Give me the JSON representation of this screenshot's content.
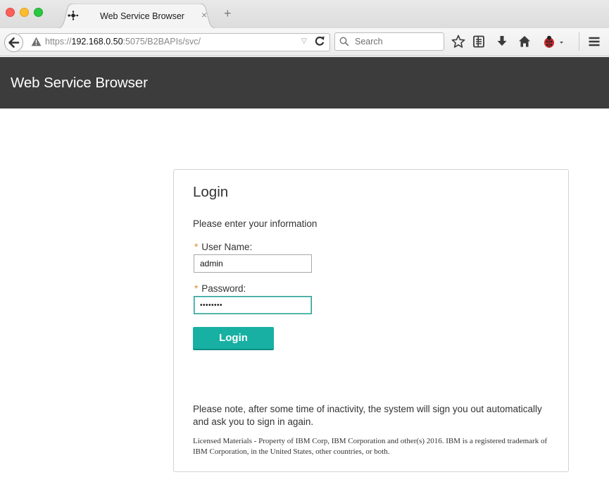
{
  "browser": {
    "tab": {
      "title": "Web Service Browser",
      "close_glyph": "×"
    },
    "new_tab_glyph": "+",
    "url": {
      "scheme": "https://",
      "host": "192.168.0.50",
      "rest": ":5075/B2BAPIs/svc/"
    },
    "search_placeholder": "Search",
    "url_dropmark": "▽",
    "toolbar_icons": [
      "bookmark-star-icon",
      "reader-list-icon",
      "download-icon",
      "home-icon",
      "ladybug-extension-icon",
      "menu-icon"
    ]
  },
  "app": {
    "title": "Web Service Browser"
  },
  "login": {
    "heading": "Login",
    "instructions": "Please enter your information",
    "required_mark": "*",
    "username_label": "User Name:",
    "username_value": "admin",
    "password_label": "Password:",
    "password_value": "••••••••",
    "button_label": "Login",
    "note": "Please note, after some time of inactivity, the system will sign you out automatically and ask you to sign in again.",
    "legal": "Licensed Materials - Property of IBM Corp, IBM Corporation and other(s) 2016. IBM is a registered trademark of IBM Corporation, in the United States, other countries, or both."
  },
  "colors": {
    "header_bg": "#3c3c3c",
    "accent": "#17b0a3",
    "required": "#e08a2c"
  }
}
